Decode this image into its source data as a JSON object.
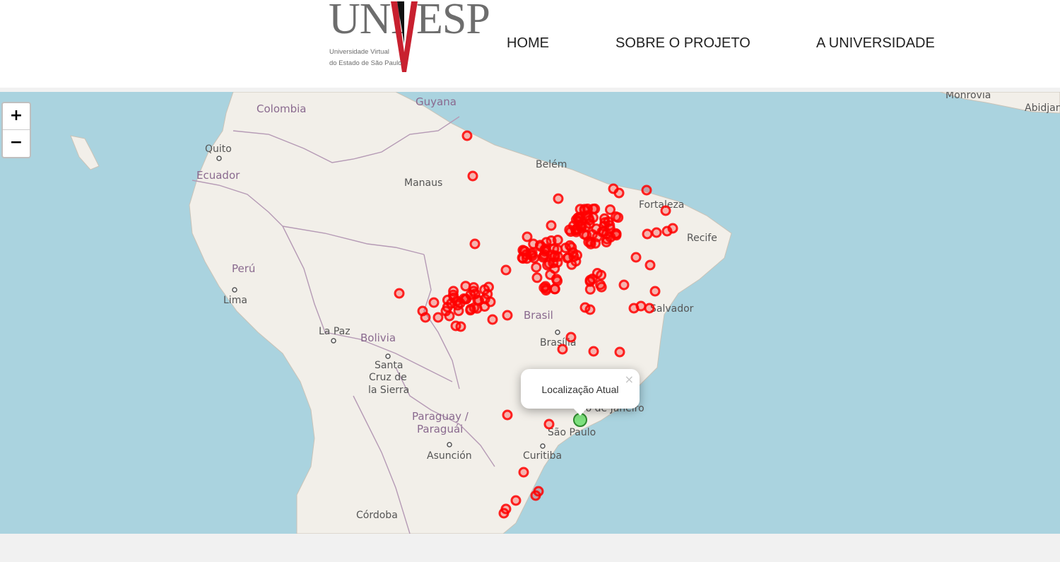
{
  "logo": {
    "word_left": "UNI",
    "word_right": "ESP",
    "subtitle_line1": "Universidade Virtual",
    "subtitle_line2": "do Estado de São Paulo",
    "accent_color": "#c8202f"
  },
  "nav": {
    "items": [
      {
        "label": "HOME"
      },
      {
        "label": "SOBRE O PROJETO"
      },
      {
        "label": "A UNIVERSIDADE"
      }
    ]
  },
  "map": {
    "zoom_in_label": "+",
    "zoom_out_label": "−",
    "colors": {
      "water": "#aad3df",
      "land": "#f2efe9",
      "border": "#b59ab5",
      "marker": "#ff0000",
      "current": "#7ee07e"
    },
    "labels": {
      "cities": [
        "Quito",
        "Manaus",
        "Belém",
        "Fortaleza",
        "Recife",
        "Lima",
        "La Paz",
        "Santa",
        "Cruz de",
        "la Sierra",
        "Salvador",
        "Brasília",
        "Asunción",
        "Curitiba",
        "São Paulo",
        "Córdoba",
        "Monrovia",
        "Abidjan",
        "Rio de Janeiro"
      ],
      "countries": [
        "Colombia",
        "Guyana",
        "Ecuador",
        "Perú",
        "Bolivia",
        "Brasil",
        "Paraguay /",
        "Paraguái"
      ]
    },
    "marker_count": 200,
    "popup": {
      "text": "Localização Atual",
      "close": "×"
    }
  }
}
